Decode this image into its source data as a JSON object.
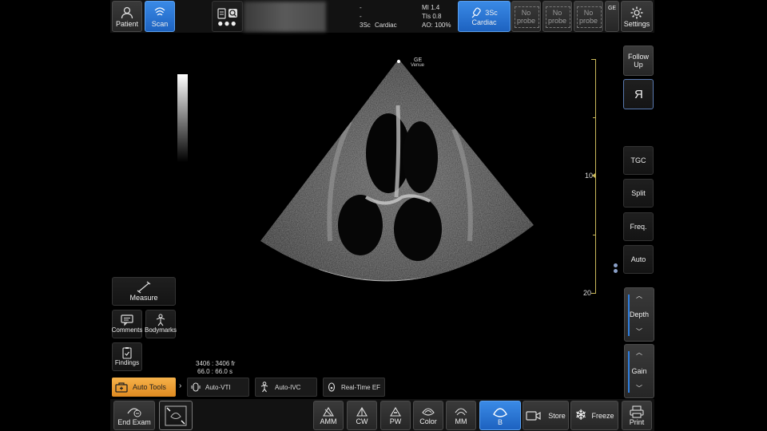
{
  "top": {
    "patient_label": "Patient",
    "scan_label": "Scan",
    "info_line1": "-",
    "info_line2": "-",
    "probe_preset": "3Sc",
    "preset_name": "Cardiac",
    "mi": "MI 1.4",
    "tis": "TIs 0.8",
    "ao": "AO: 100%",
    "probe_button_name": "3Sc",
    "probe_button_preset": "Cardiac",
    "no_probe_1": "No probe",
    "no_probe_2": "No probe",
    "no_probe_3": "No probe",
    "settings_label": "Settings",
    "small_label": "GE"
  },
  "image": {
    "logo_text": "GE",
    "logo_sub": "Venue",
    "depth_mark_10": "10",
    "depth_mark_20": "20"
  },
  "left_tools": {
    "measure": "Measure",
    "comments": "Comments",
    "bodymarks": "Bodymarks",
    "findings": "Findings",
    "frame_count": "3406 : 3406 fr",
    "time_count": "66.0 : 66.0 s",
    "auto_tools": "Auto Tools",
    "auto_vti": "Auto-VTI",
    "auto_ivc": "Auto-IVC",
    "realtime_ef": "Real-Time EF"
  },
  "right": {
    "follow_up": "Follow Up",
    "orient_glyph": "R",
    "tgc": "TGC",
    "split": "Split",
    "freq": "Freq.",
    "auto": "Auto",
    "depth": "Depth",
    "gain": "Gain"
  },
  "bottom": {
    "end_exam": "End Exam",
    "amm": "AMM",
    "cw": "CW",
    "pw": "PW",
    "color": "Color",
    "mm": "MM",
    "b": "B",
    "store": "Store",
    "freeze": "Freeze",
    "print": "Print"
  },
  "colors": {
    "accent": "#2f7fe0",
    "auto_tools": "#f0a030"
  }
}
